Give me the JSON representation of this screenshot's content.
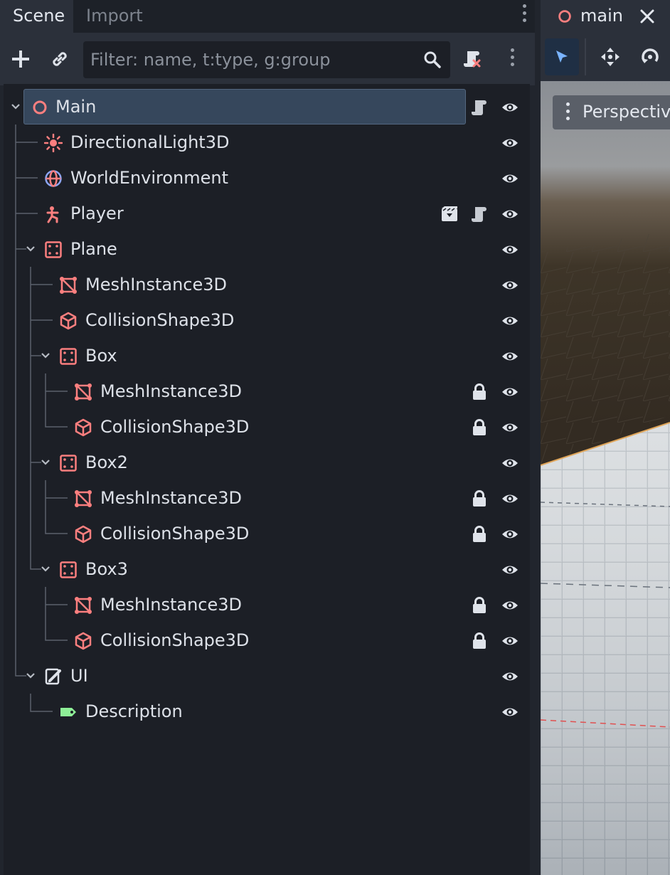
{
  "dock": {
    "tabs": [
      {
        "label": "Scene",
        "active": true
      },
      {
        "label": "Import",
        "active": false
      }
    ]
  },
  "toolbar": {
    "add_icon": "plus-icon",
    "link_icon": "link-icon",
    "filter_placeholder": "Filter: name, t:type, g:group",
    "search_icon": "search-icon",
    "script_filter_icon": "script-remove-icon",
    "menu_icon": "kebab-icon"
  },
  "tree": {
    "nodes": [
      {
        "label": "Main",
        "icon": "node3d-circle-icon",
        "selected": true,
        "actions": [
          "script-icon",
          "visibility-icon"
        ]
      },
      {
        "label": "DirectionalLight3D",
        "icon": "directional-light-icon",
        "actions": [
          "visibility-icon"
        ]
      },
      {
        "label": "WorldEnvironment",
        "icon": "world-environment-icon",
        "actions": [
          "visibility-icon"
        ]
      },
      {
        "label": "Player",
        "icon": "character-body-icon",
        "actions": [
          "instance-icon",
          "script-icon",
          "visibility-icon"
        ]
      },
      {
        "label": "Plane",
        "icon": "static-body-icon",
        "expanded": true,
        "actions": [
          "visibility-icon"
        ]
      },
      {
        "label": "MeshInstance3D",
        "icon": "mesh-instance-icon",
        "actions": [
          "visibility-icon"
        ]
      },
      {
        "label": "CollisionShape3D",
        "icon": "collision-shape-icon",
        "actions": [
          "visibility-icon"
        ]
      },
      {
        "label": "Box",
        "icon": "static-body-icon",
        "expanded": true,
        "actions": [
          "visibility-icon"
        ]
      },
      {
        "label": "MeshInstance3D",
        "icon": "mesh-instance-icon",
        "actions": [
          "lock-icon",
          "visibility-icon"
        ]
      },
      {
        "label": "CollisionShape3D",
        "icon": "collision-shape-icon",
        "actions": [
          "lock-icon",
          "visibility-icon"
        ]
      },
      {
        "label": "Box2",
        "icon": "static-body-icon",
        "expanded": true,
        "actions": [
          "visibility-icon"
        ]
      },
      {
        "label": "MeshInstance3D",
        "icon": "mesh-instance-icon",
        "actions": [
          "lock-icon",
          "visibility-icon"
        ]
      },
      {
        "label": "CollisionShape3D",
        "icon": "collision-shape-icon",
        "actions": [
          "lock-icon",
          "visibility-icon"
        ]
      },
      {
        "label": "Box3",
        "icon": "static-body-icon",
        "expanded": true,
        "actions": [
          "visibility-icon"
        ]
      },
      {
        "label": "MeshInstance3D",
        "icon": "mesh-instance-icon",
        "actions": [
          "lock-icon",
          "visibility-icon"
        ]
      },
      {
        "label": "CollisionShape3D",
        "icon": "collision-shape-icon",
        "actions": [
          "lock-icon",
          "visibility-icon"
        ]
      },
      {
        "label": "UI",
        "icon": "control-icon",
        "expanded": true,
        "actions": [
          "visibility-icon"
        ]
      },
      {
        "label": "Description",
        "icon": "label-icon",
        "actions": [
          "visibility-icon"
        ]
      }
    ]
  },
  "editor": {
    "tab": {
      "label": "main",
      "icon": "node3d-circle-icon",
      "close_icon": "close-icon"
    },
    "tools": [
      "select-tool-icon",
      "move-tool-icon",
      "rotate-tool-icon"
    ],
    "viewport": {
      "perspective_label": "Perspective"
    }
  },
  "colors": {
    "node3d": "#fc7f7f",
    "control": "#8eef97",
    "selection": "#36475c",
    "accent": "#7ab4ff"
  }
}
